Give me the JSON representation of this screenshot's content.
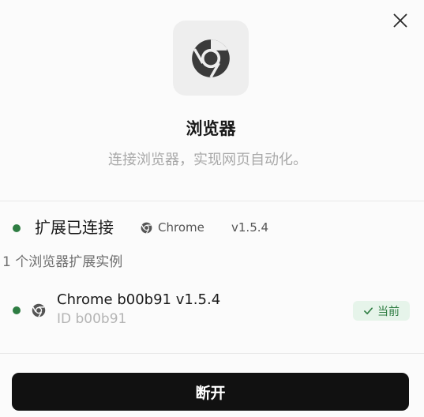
{
  "header": {
    "close_icon": "close-icon",
    "hero_icon": "chrome-icon",
    "title": "浏览器",
    "subtitle": "连接浏览器，实现网页自动化。"
  },
  "status": {
    "label": "扩展已连接",
    "browser_name": "Chrome",
    "version": "v1.5.4",
    "color": "#2e7d42"
  },
  "instances": {
    "count_label": "1 个浏览器扩展实例",
    "items": [
      {
        "name": "Chrome b00b91 v1.5.4",
        "id_label": "ID b00b91",
        "badge": "当前"
      }
    ]
  },
  "actions": {
    "disconnect_label": "断开"
  },
  "colors": {
    "accent_green": "#2e7d42",
    "badge_bg": "#e6f4ea",
    "button_bg": "#111111"
  }
}
